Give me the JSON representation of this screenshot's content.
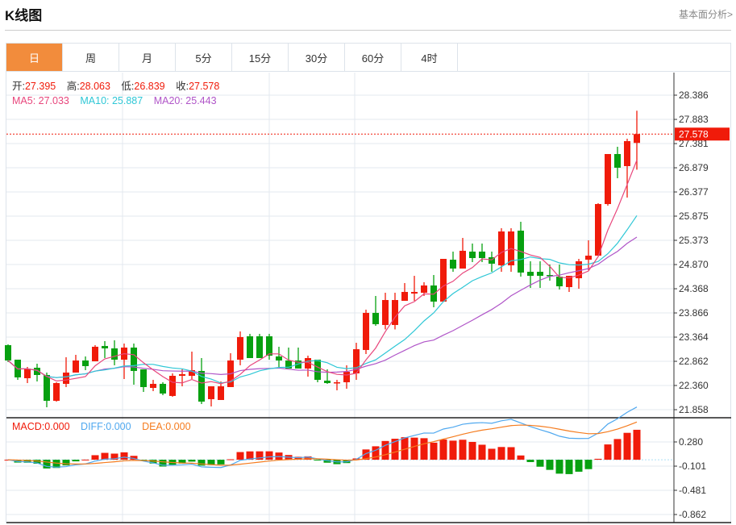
{
  "header": {
    "title": "K线图",
    "more_link": "基本面分析>"
  },
  "tabs": [
    {
      "label": "日",
      "active": true
    },
    {
      "label": "周"
    },
    {
      "label": "月"
    },
    {
      "label": "5分"
    },
    {
      "label": "15分"
    },
    {
      "label": "30分"
    },
    {
      "label": "60分"
    },
    {
      "label": "4时"
    }
  ],
  "ohlc_info": {
    "open_label": "开:",
    "open": "27.395",
    "high_label": "高:",
    "high": "28.063",
    "low_label": "低:",
    "low": "26.839",
    "close_label": "收:",
    "close": "27.578"
  },
  "ma_info": {
    "ma5": "MA5: 27.033",
    "ma10": "MA10: 25.887",
    "ma20": "MA20: 25.443"
  },
  "macd_info": {
    "macd": "MACD:0.000",
    "diff": "DIFF:0.000",
    "dea": "DEA:0.000"
  },
  "colors": {
    "up": "#f01b0a",
    "down": "#07a010",
    "ma5": "#e8467c",
    "ma10": "#2ec7d6",
    "ma20": "#b055c8",
    "diff": "#4fa8ef",
    "dea": "#f57c1f",
    "accent": "#f28c3c"
  },
  "chart_data": {
    "type": "candlestick",
    "price_axis_ticks": [
      "28.386",
      "27.883",
      "27.381",
      "26.879",
      "26.377",
      "25.875",
      "25.373",
      "24.870",
      "24.368",
      "23.866",
      "23.364",
      "22.862",
      "22.360",
      "21.858"
    ],
    "price_range": [
      21.858,
      28.386
    ],
    "last_price": "27.578",
    "macd_axis_ticks": [
      "0.280",
      "-0.101",
      "-0.481",
      "-0.862"
    ],
    "macd_range": [
      -0.862,
      0.28
    ],
    "ohlc": [
      [
        23.197,
        23.214,
        22.846,
        22.879
      ],
      [
        22.896,
        22.896,
        22.477,
        22.528
      ],
      [
        22.511,
        22.745,
        22.41,
        22.712
      ],
      [
        22.728,
        22.812,
        22.444,
        22.578
      ],
      [
        22.578,
        22.628,
        21.908,
        22.042
      ],
      [
        22.042,
        22.427,
        22.025,
        22.41
      ],
      [
        22.394,
        22.946,
        22.327,
        22.628
      ],
      [
        22.628,
        22.996,
        22.628,
        22.879
      ],
      [
        22.879,
        22.963,
        22.678,
        22.762
      ],
      [
        22.862,
        23.197,
        22.862,
        23.164
      ],
      [
        23.18,
        23.281,
        22.929,
        23.13
      ],
      [
        23.13,
        23.298,
        22.779,
        22.896
      ],
      [
        22.896,
        23.231,
        22.494,
        23.147
      ],
      [
        23.147,
        23.231,
        22.377,
        22.662
      ],
      [
        22.695,
        22.695,
        22.226,
        22.327
      ],
      [
        22.31,
        22.477,
        22.243,
        22.394
      ],
      [
        22.394,
        22.427,
        22.159,
        22.193
      ],
      [
        22.143,
        22.611,
        22.126,
        22.561
      ],
      [
        22.561,
        22.695,
        22.343,
        22.595
      ],
      [
        22.561,
        23.063,
        22.494,
        22.678
      ],
      [
        22.662,
        22.929,
        21.975,
        22.025
      ],
      [
        22.076,
        22.343,
        21.925,
        22.343
      ],
      [
        22.059,
        22.444,
        22.059,
        22.343
      ],
      [
        22.327,
        23.03,
        22.327,
        22.879
      ],
      [
        22.896,
        23.482,
        22.779,
        23.365
      ],
      [
        23.381,
        23.432,
        22.929,
        22.929
      ],
      [
        23.381,
        23.432,
        22.929,
        22.929
      ],
      [
        23.381,
        23.432,
        22.896,
        22.979
      ],
      [
        22.963,
        23.164,
        22.745,
        22.879
      ],
      [
        22.879,
        23.147,
        22.712,
        22.712
      ],
      [
        22.879,
        23.147,
        22.712,
        22.712
      ],
      [
        22.712,
        22.979,
        22.544,
        22.929
      ],
      [
        22.896,
        22.896,
        22.427,
        22.477
      ],
      [
        22.461,
        22.695,
        22.394,
        22.41
      ],
      [
        22.41,
        22.477,
        22.26,
        22.427
      ],
      [
        22.427,
        22.779,
        22.293,
        22.645
      ],
      [
        22.611,
        23.247,
        22.477,
        23.113
      ],
      [
        23.097,
        23.934,
        23.013,
        23.867
      ],
      [
        23.867,
        24.218,
        23.599,
        23.632
      ],
      [
        23.616,
        24.285,
        23.524,
        24.134
      ],
      [
        23.616,
        24.285,
        23.524,
        24.134
      ],
      [
        24.117,
        24.486,
        24.117,
        24.302
      ],
      [
        24.268,
        24.636,
        24.117,
        24.302
      ],
      [
        24.285,
        24.503,
        24.218,
        24.436
      ],
      [
        24.436,
        24.653,
        23.984,
        24.101
      ],
      [
        24.101,
        24.988,
        24.101,
        24.988
      ],
      [
        24.971,
        25.139,
        24.72,
        24.787
      ],
      [
        24.787,
        25.423,
        24.787,
        25.156
      ],
      [
        25.139,
        25.306,
        24.921,
        25.005
      ],
      [
        25.139,
        25.306,
        24.921,
        25.005
      ],
      [
        25.022,
        25.139,
        24.72,
        24.888
      ],
      [
        24.854,
        25.624,
        24.72,
        25.557
      ],
      [
        24.854,
        25.624,
        24.72,
        25.557
      ],
      [
        25.574,
        25.758,
        24.62,
        24.704
      ],
      [
        24.72,
        24.938,
        24.385,
        24.636
      ],
      [
        24.72,
        24.938,
        24.385,
        24.636
      ],
      [
        24.653,
        24.871,
        24.536,
        24.636
      ],
      [
        24.62,
        24.871,
        24.352,
        24.419
      ],
      [
        24.402,
        24.636,
        24.302,
        24.636
      ],
      [
        24.586,
        24.988,
        24.368,
        24.938
      ],
      [
        24.971,
        25.373,
        24.754,
        25.055
      ],
      [
        25.055,
        26.143,
        25.055,
        26.126
      ],
      [
        26.126,
        27.164,
        26.093,
        27.164
      ],
      [
        27.164,
        27.315,
        26.662,
        26.88
      ],
      [
        26.913,
        27.482,
        26.26,
        27.432
      ],
      [
        27.395,
        28.063,
        26.839,
        27.578
      ]
    ],
    "moving_averages": [
      "MA5",
      "MA10",
      "MA20"
    ],
    "indicator": "MACD",
    "grid": true
  }
}
